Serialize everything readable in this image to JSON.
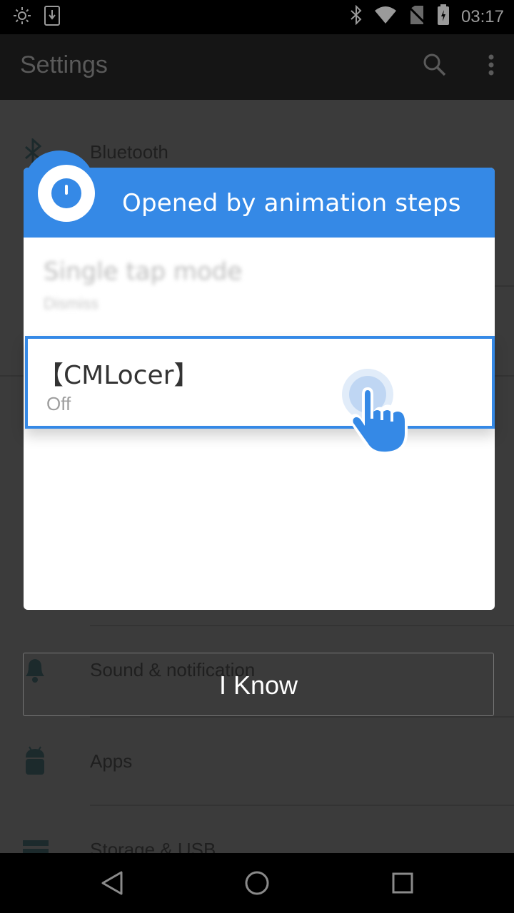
{
  "status_bar": {
    "time": "03:17",
    "icons_left": [
      "brightness-icon",
      "download-icon"
    ],
    "icons_right": [
      "bluetooth-icon",
      "wifi-icon",
      "no-sim-icon",
      "battery-icon"
    ]
  },
  "app_bar": {
    "title": "Settings",
    "actions": [
      "search-icon",
      "more-vert-icon"
    ]
  },
  "settings_list": [
    {
      "label": "Bluetooth",
      "icon": "bluetooth-icon"
    },
    {
      "label": "Sound & notification",
      "icon": "bell-icon"
    },
    {
      "label": "Apps",
      "icon": "android-icon"
    },
    {
      "label": "Storage & USB",
      "icon": "storage-icon"
    }
  ],
  "dialog": {
    "title": "Opened by animation steps",
    "blurred_item": {
      "title": "Single tap mode",
      "subtitle": "Dismiss"
    },
    "highlighted_item": {
      "title": "【CMLocer】",
      "subtitle": "Off"
    }
  },
  "confirm_button": {
    "label": "I Know"
  },
  "colors": {
    "accent": "#3589e6",
    "overlay_bg": "#3b3b3b"
  },
  "nav_bar": {
    "buttons": [
      "back-icon",
      "home-icon",
      "recents-icon"
    ]
  }
}
